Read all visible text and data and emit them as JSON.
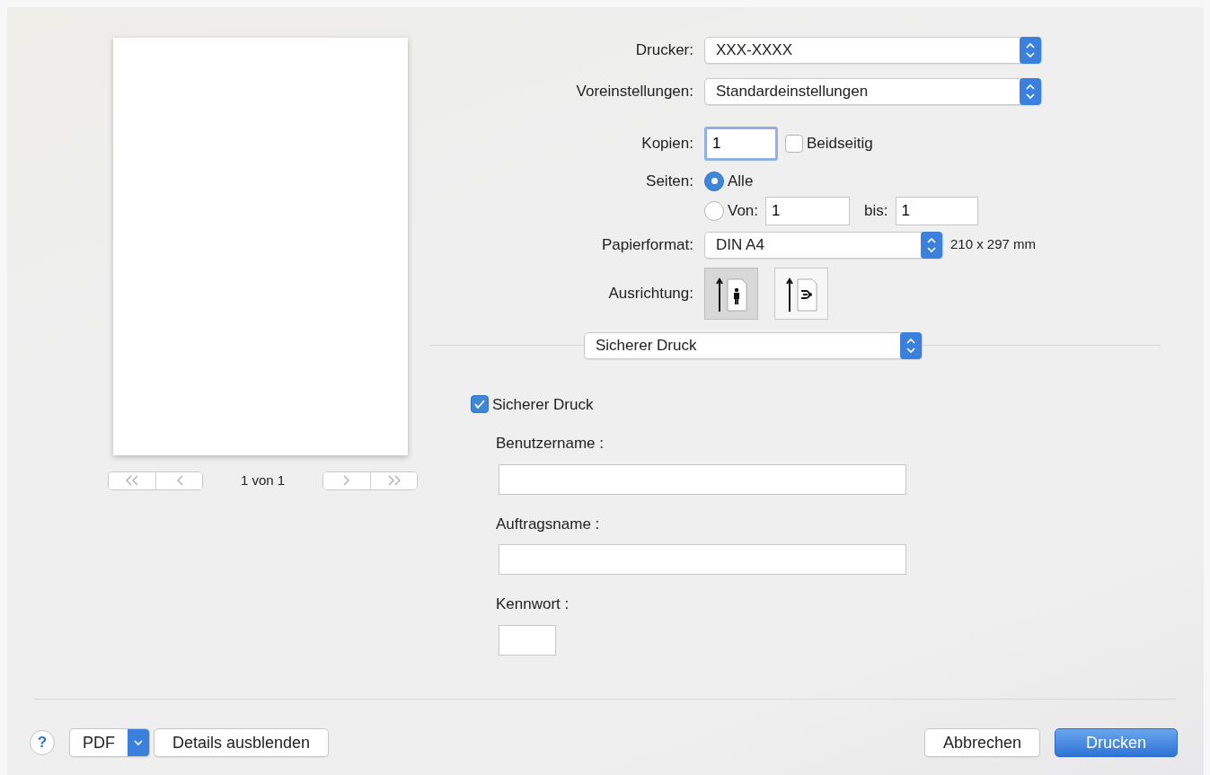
{
  "printer": {
    "label": "Drucker:",
    "value": "XXX-XXXX"
  },
  "presets": {
    "label": "Voreinstellungen:",
    "value": "Standardeinstellungen"
  },
  "copies": {
    "label": "Kopien:",
    "value": "1"
  },
  "duplex": {
    "label": "Beidseitig",
    "checked": false
  },
  "pages": {
    "label": "Seiten:",
    "options": [
      {
        "label": "Alle",
        "selected": true
      },
      {
        "label": "Von:",
        "selected": false
      }
    ],
    "from": "1",
    "to_label": "bis:",
    "to": "1"
  },
  "paper": {
    "label": "Papierformat:",
    "value": "DIN A4",
    "size": "210 x 297 mm"
  },
  "orientation": {
    "label": "Ausrichtung:",
    "options": [
      {
        "kind": "portrait",
        "selected": true
      },
      {
        "kind": "landscape",
        "selected": false
      }
    ]
  },
  "section": {
    "value": "Sicherer Druck"
  },
  "secure": {
    "label": "Sicherer Druck",
    "checked": true,
    "fields": [
      {
        "label": "Benutzername :",
        "kind": "wide"
      },
      {
        "label": "Auftragsname :",
        "kind": "wide"
      },
      {
        "label": "Kennwort :",
        "kind": "short"
      }
    ]
  },
  "preview": {
    "page_info": "1 von 1"
  },
  "footer": {
    "help": "?",
    "pdf": "PDF",
    "details": "Details ausblenden",
    "cancel": "Abbrechen",
    "print": "Drucken"
  }
}
